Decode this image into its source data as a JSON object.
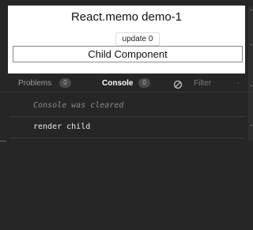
{
  "preview": {
    "title": "React.memo demo-1",
    "update_button": "update 0",
    "child_text": "Child Component"
  },
  "devtools": {
    "tabs": [
      {
        "label": "Problems",
        "count": "0"
      },
      {
        "label": "Console",
        "count": "0"
      }
    ],
    "filter_placeholder": "Filter",
    "console": {
      "cleared_message": "Console was cleared",
      "log_message": "render child"
    }
  },
  "colors": {
    "panel_bg": "#262626",
    "preview_bg": "#ffffff",
    "active_tab": "#ffffff",
    "inactive_tab": "#9a9a9a"
  },
  "icons": [
    "clear-console-icon",
    "more-options-icon"
  ]
}
